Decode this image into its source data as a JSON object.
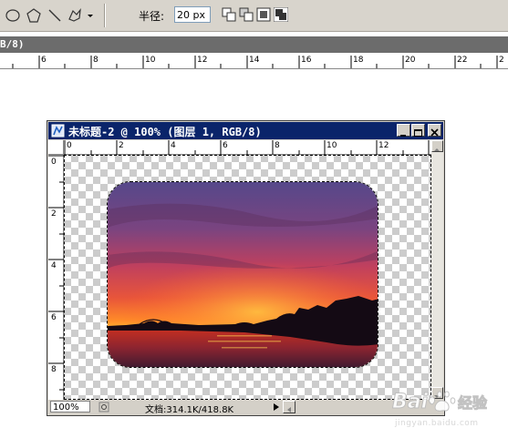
{
  "toolbar": {
    "radius_label": "半径:",
    "radius_value": "20 px",
    "shape_tools": [
      "ellipse-tool",
      "polygon-tool",
      "line-tool",
      "custom-shape-tool"
    ]
  },
  "background_document": {
    "title_fragment": "B/8)",
    "ruler_labels": [
      "6",
      "8",
      "10",
      "12",
      "14",
      "16",
      "18",
      "20",
      "22",
      "2"
    ]
  },
  "document_window": {
    "title": "未标题-2 @ 100% (图层 1, RGB/8)",
    "h_ruler_labels": [
      "0",
      "2",
      "4",
      "6",
      "8",
      "10",
      "12"
    ],
    "v_ruler_labels": [
      "0",
      "2",
      "4",
      "6",
      "8"
    ],
    "zoom": "100%",
    "doc_info": "文档:314.1K/418.8K"
  },
  "colors": {
    "titlebar": "#0a246a",
    "checker": "#cccccc",
    "sky_top": "#5a4a8a",
    "sky_glow": "#f06030",
    "horizon": "#ffa020"
  },
  "watermark": {
    "brand": "Baidu",
    "label": "经验",
    "url": "jingyan.baidu.com"
  }
}
